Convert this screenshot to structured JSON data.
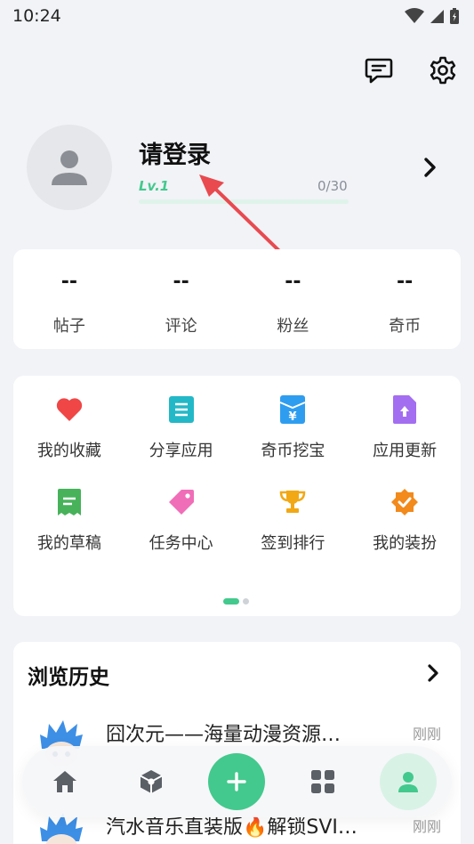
{
  "status_bar": {
    "time": "10:24"
  },
  "profile": {
    "title": "请登录",
    "level": "Lv.1",
    "progress_text": "0/30",
    "progress_fraction": 0
  },
  "stats": [
    {
      "value": "--",
      "label": "帖子"
    },
    {
      "value": "--",
      "label": "评论"
    },
    {
      "value": "--",
      "label": "粉丝"
    },
    {
      "value": "--",
      "label": "奇币"
    }
  ],
  "shortcuts": [
    {
      "label": "我的收藏",
      "icon": "heart-icon",
      "color": "#f04646"
    },
    {
      "label": "分享应用",
      "icon": "document-icon",
      "color": "#23b8c7"
    },
    {
      "label": "奇币挖宝",
      "icon": "yen-box-icon",
      "color": "#2e9df0"
    },
    {
      "label": "应用更新",
      "icon": "upload-file-icon",
      "color": "#a36ef0"
    },
    {
      "label": "我的草稿",
      "icon": "receipt-icon",
      "color": "#47b25a"
    },
    {
      "label": "任务中心",
      "icon": "tag-icon",
      "color": "#f06eb8"
    },
    {
      "label": "签到排行",
      "icon": "trophy-icon",
      "color": "#f2a814"
    },
    {
      "label": "我的装扮",
      "icon": "badge-check-icon",
      "color": "#f28a1c"
    }
  ],
  "history": {
    "title": "浏览历史",
    "items": [
      {
        "name": "囧次元——海量动漫资源…",
        "time": "刚刚"
      },
      {
        "name": "汽水音乐直装版🔥解锁SVI…",
        "time": "刚刚"
      }
    ]
  },
  "bottom_nav": [
    "home-icon",
    "cube-icon",
    "plus-icon",
    "grid-icon",
    "user-icon"
  ],
  "colors": {
    "accent": "#43c98d",
    "annotation_arrow": "#e84a4f"
  }
}
